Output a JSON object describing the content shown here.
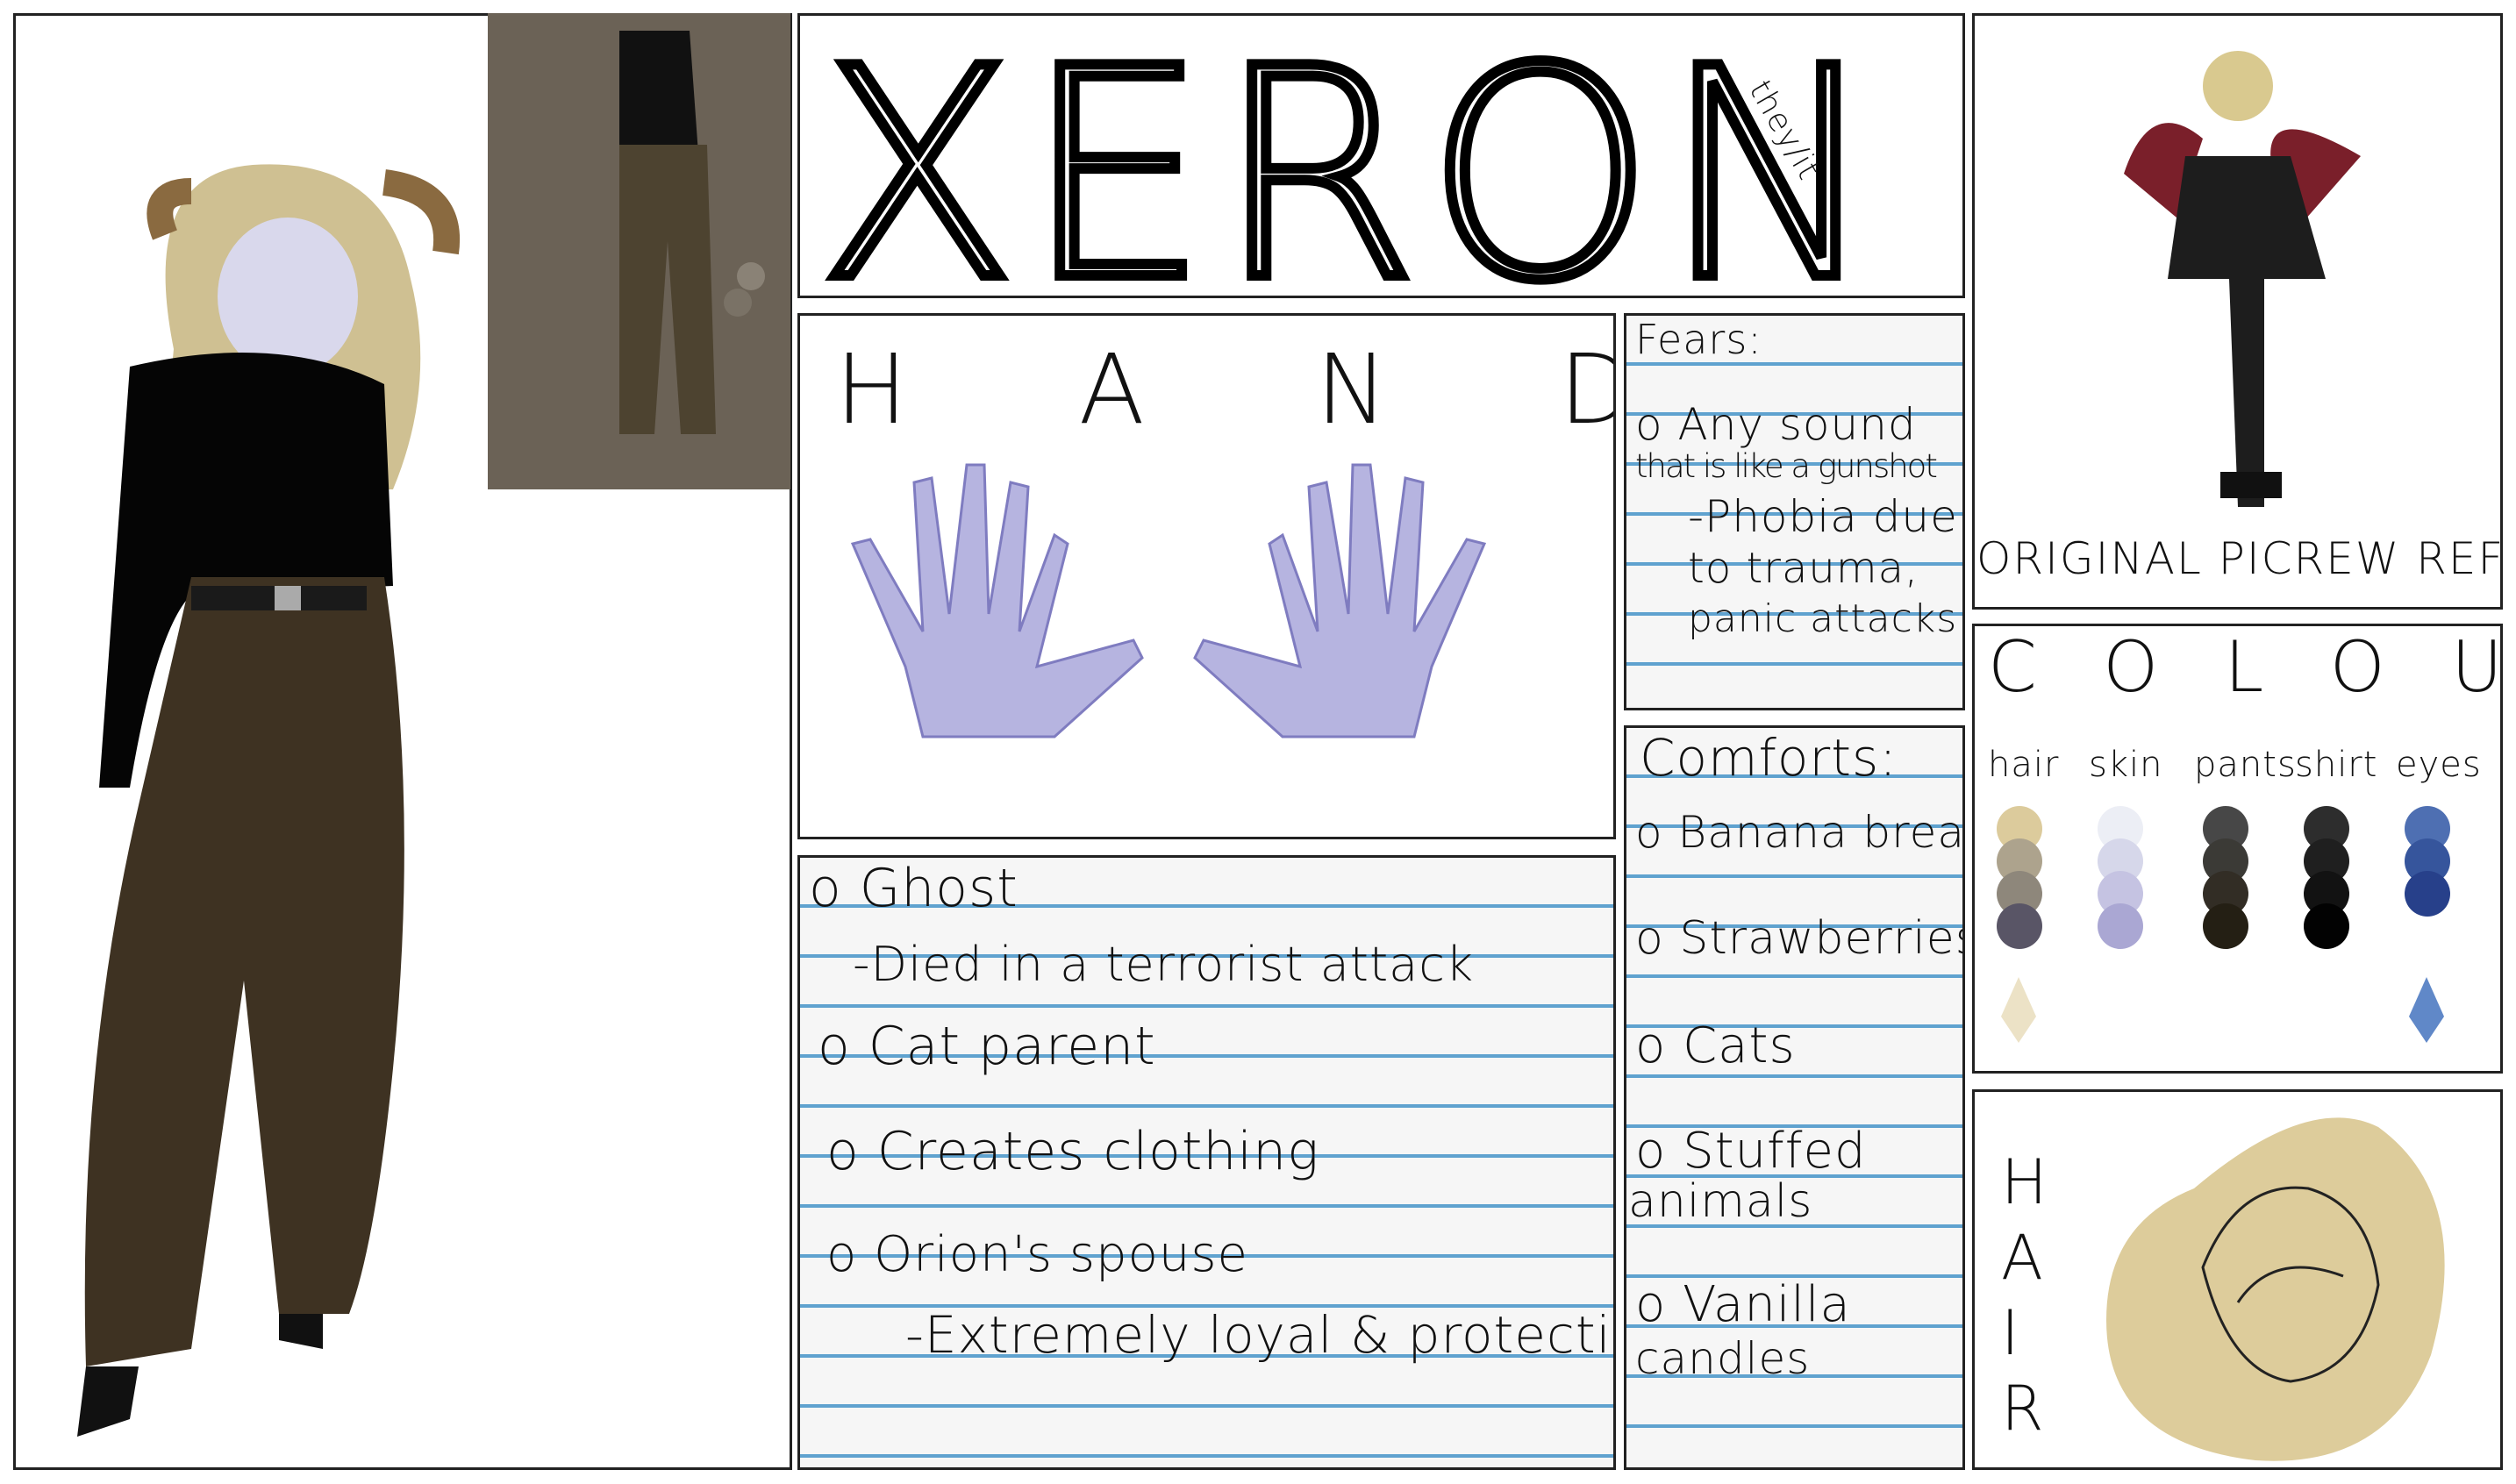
{
  "title": {
    "name": "XERON",
    "pronouns": "they/it"
  },
  "hands": {
    "label": "H A N D S"
  },
  "fears": {
    "heading": "Fears:",
    "lines": [
      "o Any  sound",
      "that is like a gunshot",
      "-Phobia  due",
      "to trauma,",
      "panic attacks"
    ]
  },
  "comforts": {
    "heading": "Comforts:",
    "items": [
      "o Banana  bread",
      "o Strawberries",
      "o Cats",
      "o Stuffed",
      "animals",
      "o Vanilla",
      "candles"
    ]
  },
  "bio": {
    "items": [
      "o Ghost",
      "-Died  in  a  terrorist attack",
      "o Cat  parent",
      "o Creates  clothing",
      "o Orion's  spouse",
      "-Extremely  loyal  &  protective"
    ]
  },
  "picrew": {
    "label": "ORIGINAL  PICREW  REF."
  },
  "colours": {
    "heading": "C O L O U R S",
    "groups": [
      {
        "label": "hair",
        "colors": [
          "#dccb9c",
          "#ada38d",
          "#8e877b",
          "#595566"
        ],
        "highlight": "#ece2c6"
      },
      {
        "label": "skin",
        "colors": [
          "#eceef5",
          "#d6d7ea",
          "#c5c3e2",
          "#aaa7d3"
        ]
      },
      {
        "label": "pants",
        "colors": [
          "#474747",
          "#3b3a36",
          "#322d25",
          "#241f14"
        ]
      },
      {
        "label": "shirt",
        "colors": [
          "#2d2d2d",
          "#1f1f1f",
          "#121212",
          "#020202"
        ]
      },
      {
        "label": "eyes",
        "colors": [
          "#4e6fb2",
          "#36559c",
          "#27408a"
        ],
        "highlight": "#6088c8"
      }
    ]
  },
  "hair": {
    "label": "HAIR",
    "bg": "#ddcc9b"
  }
}
